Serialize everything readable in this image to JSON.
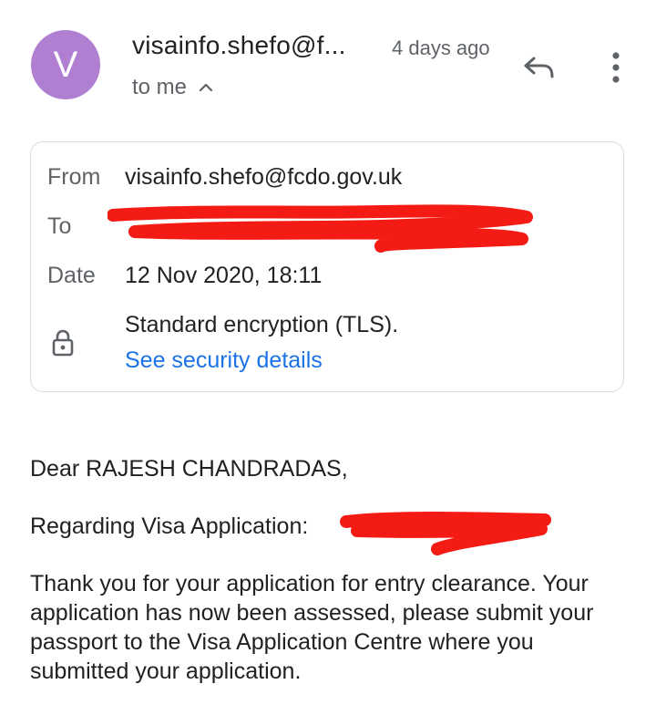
{
  "header": {
    "avatar_letter": "V",
    "avatar_color": "#b07fd1",
    "sender": "visainfo.shefo@f...",
    "time": "4 days ago",
    "to_me": "to me",
    "reply_icon": "reply-icon",
    "more_icon": "more-vert-icon"
  },
  "details": {
    "from_label": "From",
    "from_value": "visainfo.shefo@fcdo.gov.uk",
    "to_label": "To",
    "date_label": "Date",
    "date_value": "12 Nov 2020, 18:11",
    "encryption": "Standard encryption (TLS).",
    "security_link": "See security details",
    "lock_icon": "lock-icon"
  },
  "body": {
    "greeting": "Dear RAJESH CHANDRADAS,",
    "regarding": "Regarding Visa Application:",
    "paragraph": "Thank you for your application for entry clearance. Your application has now been assessed, please submit your passport to the Visa Application Centre where you submitted your application."
  },
  "colors": {
    "redaction": "#f31b14",
    "link": "#1a73e8"
  }
}
